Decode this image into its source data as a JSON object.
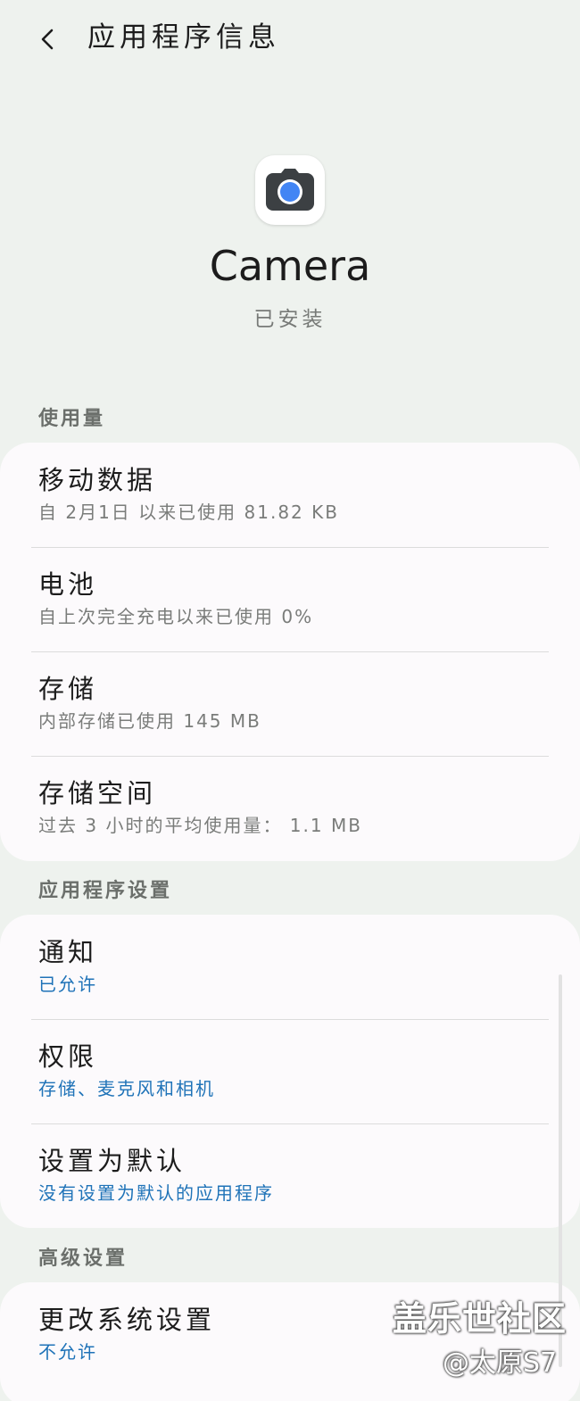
{
  "header": {
    "title": "应用程序信息"
  },
  "app": {
    "name": "Camera",
    "status": "已安装"
  },
  "sections": [
    {
      "label": "使用量",
      "rows": [
        {
          "title": "移动数据",
          "subtitle": "自 2月1日 以来已使用 81.82 KB"
        },
        {
          "title": "电池",
          "subtitle": "自上次完全充电以来已使用 0%"
        },
        {
          "title": "存储",
          "subtitle": "内部存储已使用 145 MB"
        },
        {
          "title": "存储空间",
          "subtitle": "过去 3 小时的平均使用量： 1.1 MB"
        }
      ]
    },
    {
      "label": "应用程序设置",
      "rows": [
        {
          "title": "通知",
          "subtitle": "已允许"
        },
        {
          "title": "权限",
          "subtitle": "存储、麦克风和相机"
        },
        {
          "title": "设置为默认",
          "subtitle": "没有设置为默认的应用程序"
        }
      ]
    },
    {
      "label": "高级设置",
      "rows": [
        {
          "title": "更改系统设置",
          "subtitle": "不允许"
        }
      ]
    }
  ],
  "watermark": {
    "line1": "盖乐世社区",
    "line2": "@太原S7"
  },
  "icons": {
    "back": "chevron-left-icon",
    "app": "camera-icon"
  },
  "colors": {
    "background": "#eef2ee",
    "card": "#fcfafc",
    "accent": "#1f73b8"
  }
}
